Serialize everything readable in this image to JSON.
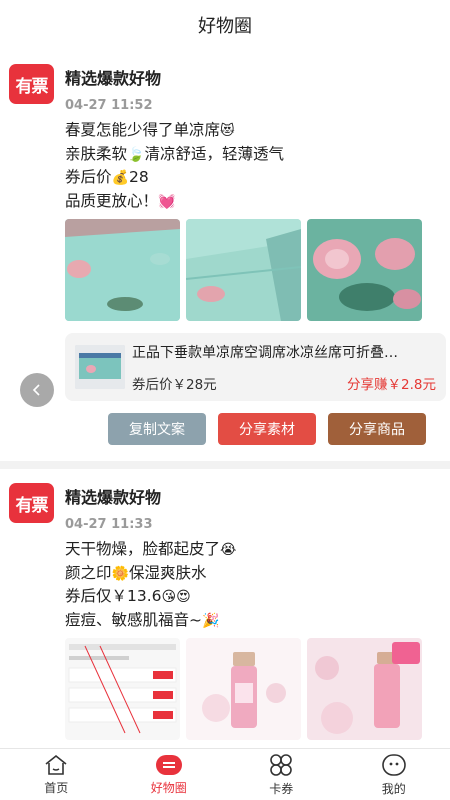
{
  "header": {
    "title": "好物圈"
  },
  "posts": [
    {
      "avatar_text": "有票",
      "author": "精选爆款好物",
      "time": "04-27 11:52",
      "lines": [
        {
          "text": "春夏怎能少得了单凉席",
          "emoji": "😻"
        },
        {
          "text": "亲肤柔软",
          "emoji": "🍃",
          "text2": "清凉舒适，轻薄透气"
        },
        {
          "text": "券后价",
          "emoji": "💰",
          "text2": "28"
        },
        {
          "text": "品质更放心！",
          "emoji": "💓"
        }
      ],
      "product": {
        "title": "正品下垂款单凉席空调席冰凉丝席可折叠…",
        "price": "券后价￥28元",
        "earn": "分享赚￥2.8元"
      },
      "buttons": {
        "copy": "复制文案",
        "material": "分享素材",
        "goods": "分享商品"
      }
    },
    {
      "avatar_text": "有票",
      "author": "精选爆款好物",
      "time": "04-27 11:33",
      "lines": [
        {
          "text": "天干物燥，脸都起皮了",
          "emoji": "😭"
        },
        {
          "text": "颜之印",
          "emoji": "🌼",
          "text2": "保湿爽肤水"
        },
        {
          "text": "券后仅￥13.6",
          "emoji": "😘😍"
        },
        {
          "text": "痘痘、敏感肌福音~",
          "emoji": "🎉"
        }
      ]
    }
  ],
  "tabbar": [
    {
      "label": "首页",
      "icon": "home-icon"
    },
    {
      "label": "好物圈",
      "icon": "ticket-icon"
    },
    {
      "label": "卡券",
      "icon": "card-icon"
    },
    {
      "label": "我的",
      "icon": "profile-icon"
    }
  ],
  "colors": {
    "brand": "#e8323c",
    "copy_btn": "#8da2ad",
    "material_btn": "#e34d44",
    "goods_btn": "#a0603a"
  }
}
